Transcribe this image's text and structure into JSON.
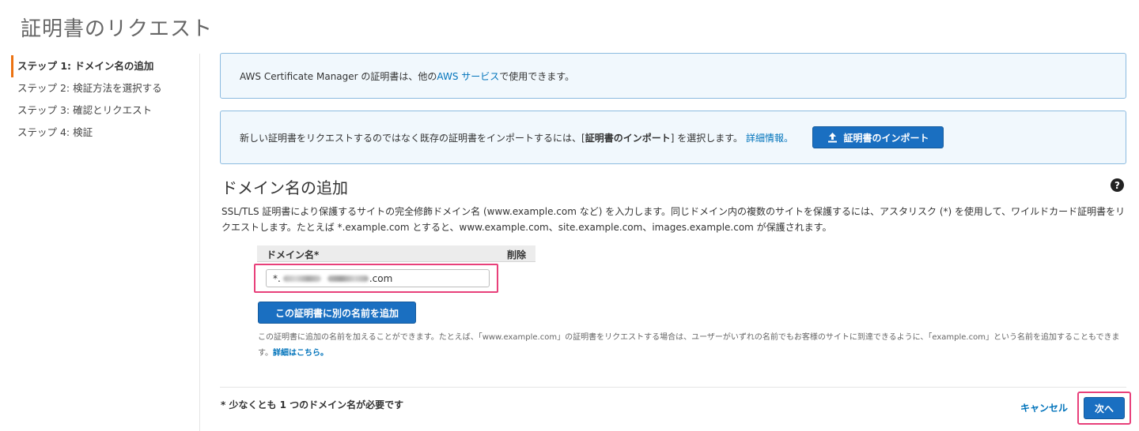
{
  "page": {
    "title": "証明書のリクエスト"
  },
  "steps": [
    {
      "label": "ステップ 1: ドメイン名の追加",
      "active": true
    },
    {
      "label": "ステップ 2: 検証方法を選択する",
      "active": false
    },
    {
      "label": "ステップ 3: 確認とリクエスト",
      "active": false
    },
    {
      "label": "ステップ 4: 検証",
      "active": false
    }
  ],
  "info1": {
    "text_before": "AWS Certificate Manager の証明書は、他の ",
    "link": "AWS サービス",
    "text_after": "で使用できます。"
  },
  "info2": {
    "text_before": "新しい証明書をリクエストするのではなく既存の証明書をインポートするには、[",
    "bold": "証明書のインポート",
    "text_after": "] を選択します。",
    "link": "詳細情報。",
    "button": "証明書のインポート",
    "button_icon": "upload-icon"
  },
  "section": {
    "title": "ドメイン名の追加",
    "help_icon": "?",
    "description": "SSL/TLS 証明書により保護するサイトの完全修飾ドメイン名 (www.example.com など) を入力します。同じドメイン内の複数のサイトを保護するには、アスタリスク (*) を使用して、ワイルドカード証明書をリクエストします。たとえば *.example.com とすると、www.example.com、site.example.com、images.example.com が保護されます。"
  },
  "domain_table": {
    "header_domain": "ドメイン名*",
    "header_delete": "削除",
    "input_prefix": "*.",
    "input_suffix": ".com"
  },
  "add_name_button": "この証明書に別の名前を追加",
  "note": {
    "text": "この証明書に追加の名前を加えることができます。たとえば、「www.example.com」の証明書をリクエストする場合は、ユーザーがいずれの名前でもお客様のサイトに到達できるように、「example.com」という名前を追加することもできます。",
    "link": "詳細はこちら。"
  },
  "footer": {
    "required_note": "* 少なくとも 1 つのドメイン名が必要です",
    "cancel": "キャンセル",
    "next": "次へ"
  },
  "colors": {
    "primary_button": "#1a6fc1",
    "link": "#0073bb",
    "highlight": "#e8407a",
    "active_step_bar": "#ec7211",
    "info_bg": "#f1f8fd"
  }
}
